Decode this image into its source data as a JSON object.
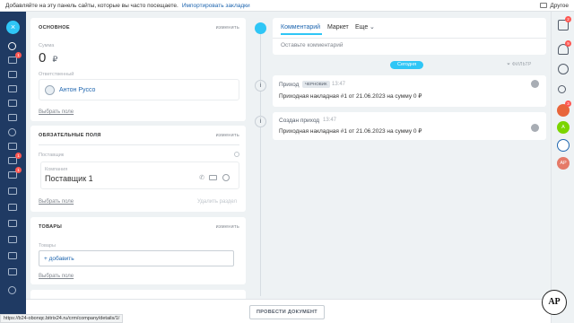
{
  "bookmarks_bar": {
    "prompt": "Добавляйте на эту панель сайты, которые вы часто посещаете.",
    "import_link": "Импортировать закладки",
    "other": "Другое"
  },
  "left_nav": {
    "close": "×",
    "badges": [
      "1",
      "1",
      "1"
    ]
  },
  "main_section": {
    "title": "ОСНОВНОЕ",
    "action": "изменить",
    "sum_label": "Сумма",
    "sum_value": "0",
    "currency": "₽",
    "responsible_label": "Ответственный",
    "responsible_name": "Антон Руссо",
    "choose_field": "Выбрать поле"
  },
  "required_section": {
    "title": "ОБЯЗАТЕЛЬНЫЕ ПОЛЯ",
    "action": "изменить",
    "supplier_label": "Поставщик",
    "company_label": "Компания",
    "company_value": "Поставщик 1",
    "choose_field": "Выбрать поле",
    "delete_section": "Удалить раздел"
  },
  "goods_section": {
    "title": "ТОВАРЫ",
    "action": "изменить",
    "goods_label": "Товары",
    "add_button": "+ добавить",
    "choose_field": "Выбрать поле"
  },
  "timeline": {
    "tabs": [
      "Комментарий",
      "Маркет",
      "Еще"
    ],
    "comment_placeholder": "Оставьте комментарий",
    "today_label": "Сегодня",
    "filter_label": "ФИЛЬТР",
    "events": [
      {
        "title": "Приход",
        "tag": "ЧЕРНОВИК",
        "time": "13:47",
        "text": "Приходная накладная #1 от 21.06.2023 на сумму 0 ₽"
      },
      {
        "title": "Создан приход",
        "tag": "",
        "time": "13:47",
        "text": "Приходная накладная #1 от 21.06.2023 на сумму 0 ₽"
      }
    ]
  },
  "right_nav": {
    "badges": [
      "2",
      "9",
      "3"
    ],
    "avatar_a": "A",
    "avatar_ap": "AP"
  },
  "bottom_bar": {
    "submit_button": "ПРОВЕСТИ ДОКУМЕНТ"
  },
  "status_url": "https://b24-obonqc.bitrix24.ru/crm/company/details/1/",
  "brand_logo": "AP",
  "colors": {
    "sidebar": "#1f3a63",
    "accent": "#2fc6f6",
    "badge": "#ff5752",
    "link": "#2067b0"
  }
}
